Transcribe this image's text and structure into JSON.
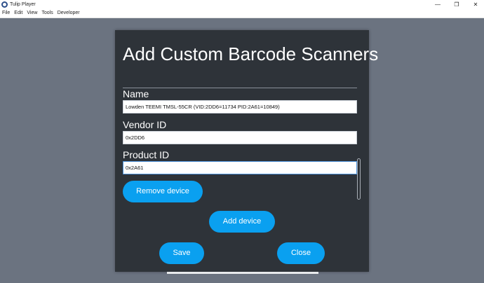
{
  "window": {
    "title": "Tulip Player",
    "minimize": "—",
    "restore": "❐",
    "close": "✕"
  },
  "menu": [
    "File",
    "Edit",
    "View",
    "Tools",
    "Developer"
  ],
  "dialog": {
    "title": "Add Custom Barcode Scanners",
    "fields": {
      "name": {
        "label": "Name",
        "value": "Lowden TEEMI TMSL-55CR (VID:2DD6=11734 PID:2A61=10849)"
      },
      "vendor_id": {
        "label": "Vendor ID",
        "value": "0x2DD6"
      },
      "product_id": {
        "label": "Product ID",
        "value": "0x2A61"
      }
    },
    "buttons": {
      "remove": "Remove device",
      "add": "Add device",
      "save": "Save",
      "close": "Close"
    }
  },
  "colors": {
    "background": "#6b7380",
    "dialog": "#2e3339",
    "accent": "#0aa0f0"
  }
}
